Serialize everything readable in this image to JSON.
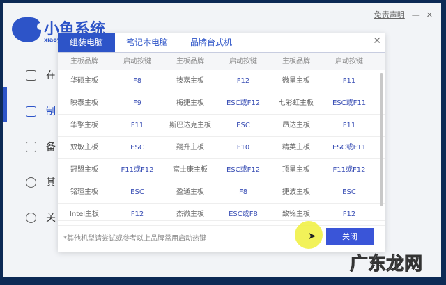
{
  "app": {
    "brand": "小鱼系统",
    "brand_sub": "xiaoy",
    "disclaimer": "免责声明",
    "minimize": "—",
    "close": "✕"
  },
  "sidebar": {
    "items": [
      {
        "label": "在",
        "icon": "online-icon"
      },
      {
        "label": "制",
        "icon": "usb-icon"
      },
      {
        "label": "备",
        "icon": "backup-icon"
      },
      {
        "label": "其",
        "icon": "settings-icon"
      },
      {
        "label": "关",
        "icon": "info-icon"
      }
    ]
  },
  "dialog": {
    "tabs": [
      "组装电脑",
      "笔记本电脑",
      "品牌台式机"
    ],
    "close": "✕",
    "headers": [
      "主板品牌",
      "启动按键",
      "主板品牌",
      "启动按键",
      "主板品牌",
      "启动按键"
    ],
    "rows": [
      [
        "华硕主板",
        "F8",
        "技嘉主板",
        "F12",
        "微星主板",
        "F11"
      ],
      [
        "映泰主板",
        "F9",
        "梅捷主板",
        "ESC或F12",
        "七彩虹主板",
        "ESC或F11"
      ],
      [
        "华擎主板",
        "F11",
        "斯巴达克主板",
        "ESC",
        "昂达主板",
        "F11"
      ],
      [
        "双敏主板",
        "ESC",
        "翔升主板",
        "F10",
        "精英主板",
        "ESC或F11"
      ],
      [
        "冠盟主板",
        "F11或F12",
        "富士康主板",
        "ESC或F12",
        "顶星主板",
        "F11或F12"
      ],
      [
        "铭瑄主板",
        "ESC",
        "盈通主板",
        "F8",
        "捷波主板",
        "ESC"
      ],
      [
        "Intel主板",
        "F12",
        "杰微主板",
        "ESC或F8",
        "致铭主板",
        "F12"
      ]
    ],
    "note": "*其他机型请尝试或参考以上品牌常用启动热键",
    "button": "关闭"
  },
  "watermark": "广东龙网"
}
